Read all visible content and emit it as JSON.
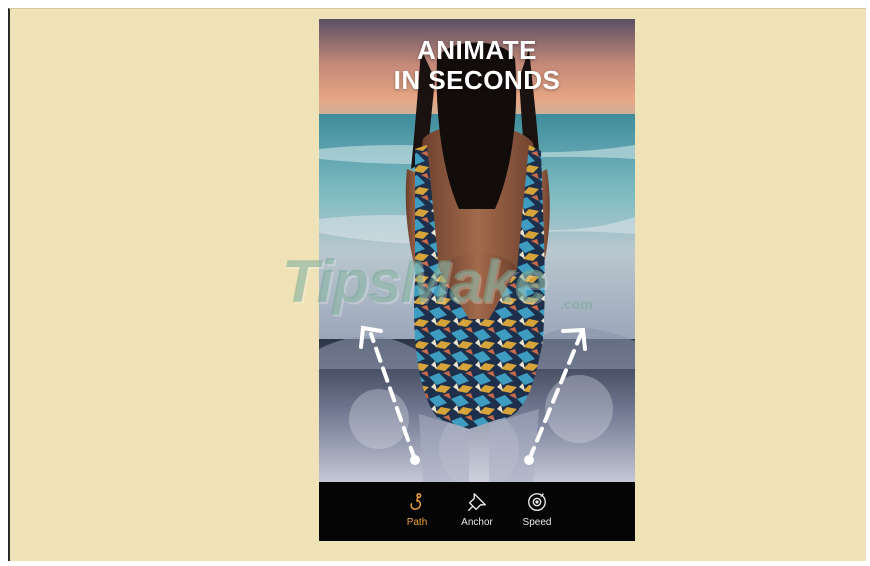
{
  "headline": {
    "line1": "ANIMATE",
    "line2": "IN SECONDS"
  },
  "toolbar": {
    "items": [
      {
        "label": "Path",
        "icon": "path-icon",
        "active": true
      },
      {
        "label": "Anchor",
        "icon": "anchor-pin-icon",
        "active": false
      },
      {
        "label": "Speed",
        "icon": "speed-dial-icon",
        "active": false
      }
    ]
  },
  "watermark": {
    "text": "TipsMake",
    "suffix": ".com"
  },
  "colors": {
    "background": "#efe2b6",
    "accent": "#f0a23a",
    "toolbar": "#050505"
  }
}
